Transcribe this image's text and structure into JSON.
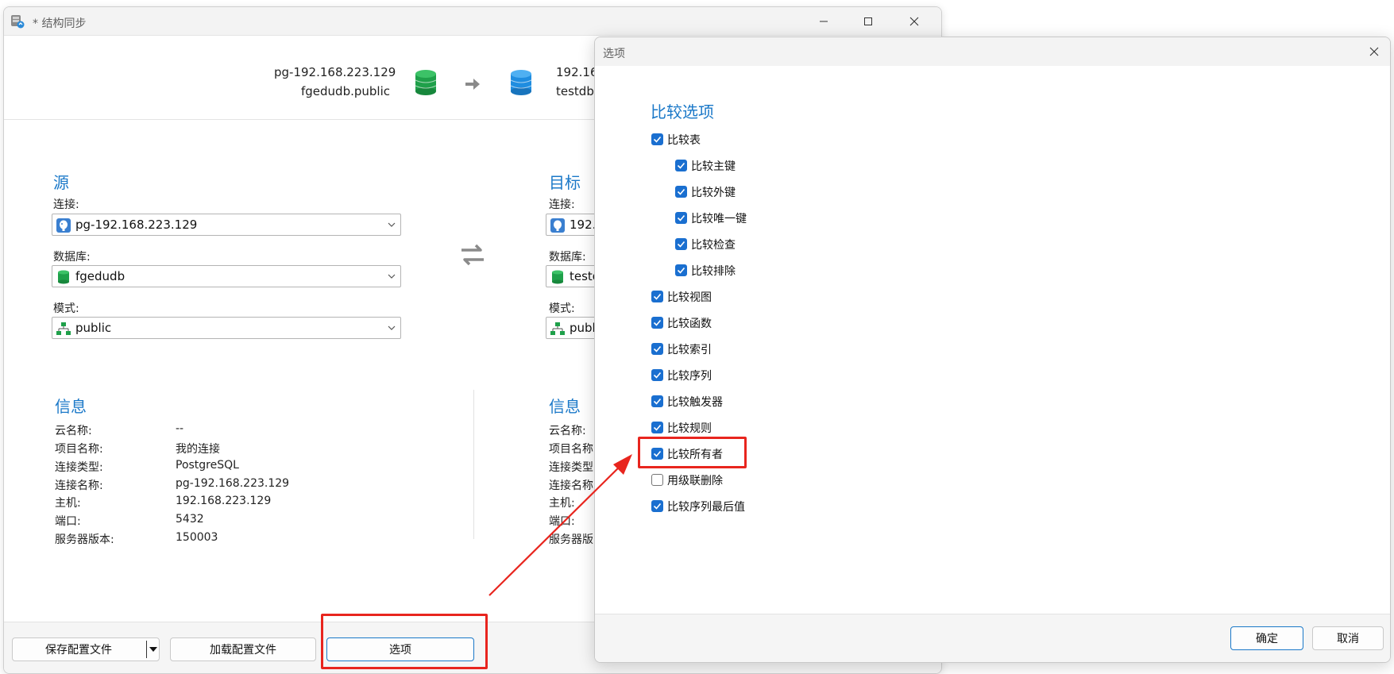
{
  "main_window": {
    "title": "* 结构同步",
    "header": {
      "source_conn": "pg-192.168.223.129",
      "source_db": "fgedudb.public",
      "target_conn": "192.16",
      "target_db": "testdb."
    },
    "source": {
      "title": "源",
      "connection_label": "连接:",
      "connection_value": "pg-192.168.223.129",
      "database_label": "数据库:",
      "database_value": "fgedudb",
      "schema_label": "模式:",
      "schema_value": "public"
    },
    "target": {
      "title": "目标",
      "connection_label": "连接:",
      "connection_value": "192.1",
      "database_label": "数据库:",
      "database_value": "testd",
      "schema_label": "模式:",
      "schema_value": "publ"
    },
    "source_info": {
      "title": "信息",
      "rows": [
        {
          "label": "云名称:",
          "value": "--"
        },
        {
          "label": "项目名称:",
          "value": "我的连接"
        },
        {
          "label": "连接类型:",
          "value": "PostgreSQL"
        },
        {
          "label": "连接名称:",
          "value": "pg-192.168.223.129"
        },
        {
          "label": "主机:",
          "value": "192.168.223.129"
        },
        {
          "label": "端口:",
          "value": "5432"
        },
        {
          "label": "服务器版本:",
          "value": "150003"
        }
      ]
    },
    "target_info": {
      "title": "信息",
      "rows": [
        {
          "label": "云名称:"
        },
        {
          "label": "项目名称"
        },
        {
          "label": "连接类型"
        },
        {
          "label": "连接名称"
        },
        {
          "label": "主机:"
        },
        {
          "label": "端口:"
        },
        {
          "label": "服务器版"
        }
      ]
    },
    "footer": {
      "save_profile": "保存配置文件",
      "load_profile": "加载配置文件",
      "options": "选项"
    }
  },
  "options_dialog": {
    "title": "选项",
    "section_title": "比较选项",
    "options": [
      {
        "label": "比较表",
        "checked": true,
        "indent": 0
      },
      {
        "label": "比较主键",
        "checked": true,
        "indent": 1
      },
      {
        "label": "比较外键",
        "checked": true,
        "indent": 1
      },
      {
        "label": "比较唯一键",
        "checked": true,
        "indent": 1
      },
      {
        "label": "比较检查",
        "checked": true,
        "indent": 1
      },
      {
        "label": "比较排除",
        "checked": true,
        "indent": 1
      },
      {
        "label": "比较视图",
        "checked": true,
        "indent": 0
      },
      {
        "label": "比较函数",
        "checked": true,
        "indent": 0
      },
      {
        "label": "比较索引",
        "checked": true,
        "indent": 0
      },
      {
        "label": "比较序列",
        "checked": true,
        "indent": 0
      },
      {
        "label": "比较触发器",
        "checked": true,
        "indent": 0
      },
      {
        "label": "比较规则",
        "checked": true,
        "indent": 0
      },
      {
        "label": "比较所有者",
        "checked": true,
        "indent": 0
      },
      {
        "label": "用级联删除",
        "checked": false,
        "indent": 0
      },
      {
        "label": "比较序列最后值",
        "checked": true,
        "indent": 0
      }
    ],
    "ok_label": "确定",
    "cancel_label": "取消"
  },
  "colors": {
    "accent": "#1a78c8",
    "checkbox": "#1a6fd0",
    "annotation": "#e8251e",
    "db_source": "#1fa04a",
    "db_target": "#1f8de0"
  }
}
